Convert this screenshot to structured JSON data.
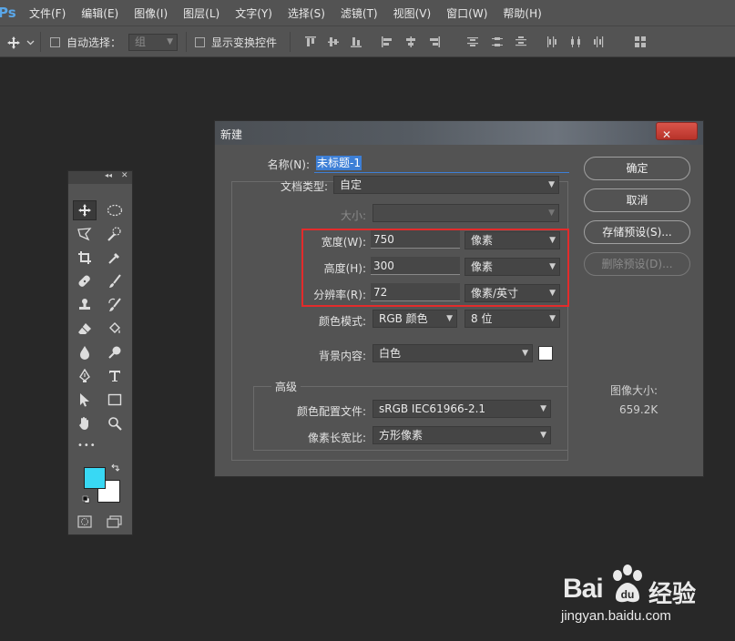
{
  "app": {
    "logo": "Ps",
    "menu": [
      "文件(F)",
      "编辑(E)",
      "图像(I)",
      "图层(L)",
      "文字(Y)",
      "选择(S)",
      "滤镜(T)",
      "视图(V)",
      "窗口(W)",
      "帮助(H)"
    ]
  },
  "options_bar": {
    "auto_select_label": "自动选择：",
    "auto_select_value": "组",
    "show_transform_label": "显示变换控件"
  },
  "tool_panel": {
    "collapse_glyph": "◂◂",
    "close_glyph": "✕",
    "more_glyph": "•••",
    "foreground_color": "#38d8f4",
    "background_color": "#ffffff"
  },
  "dialog": {
    "title": "新建",
    "close_glyph": "✕",
    "name_label": "名称(N):",
    "name_value": "未标题-1",
    "doc_type_label": "文档类型:",
    "doc_type_value": "自定",
    "size_label": "大小:",
    "size_value": "",
    "width_label": "宽度(W):",
    "width_value": "750",
    "width_unit": "像素",
    "height_label": "高度(H):",
    "height_value": "300",
    "height_unit": "像素",
    "resolution_label": "分辨率(R):",
    "resolution_value": "72",
    "resolution_unit": "像素/英寸",
    "color_mode_label": "颜色模式:",
    "color_mode_value": "RGB 颜色",
    "bit_depth_value": "8 位",
    "background_label": "背景内容:",
    "background_value": "白色",
    "background_swatch": "#ffffff",
    "advanced_label": "高级",
    "color_profile_label": "颜色配置文件:",
    "color_profile_value": "sRGB IEC61966-2.1",
    "pixel_aspect_label": "像素长宽比:",
    "pixel_aspect_value": "方形像素",
    "buttons": {
      "ok": "确定",
      "cancel": "取消",
      "save_preset": "存储预设(S)...",
      "delete_preset": "删除预设(D)..."
    },
    "image_size_label": "图像大小:",
    "image_size_value": "659.2K"
  },
  "watermark": {
    "brand": "Bai",
    "brand_suffix": "经验",
    "url": "jingyan.baidu.com"
  },
  "colors": {
    "highlight": "#e32b2b",
    "selection": "#3d7fd6"
  }
}
